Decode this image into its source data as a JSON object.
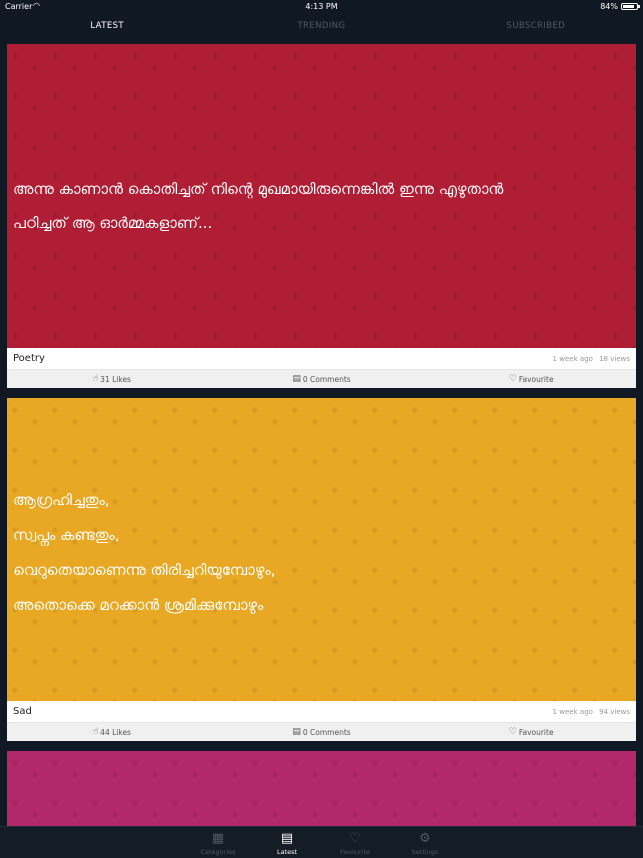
{
  "status_bar": {
    "carrier": "Carrier",
    "time": "4:13 PM",
    "battery_percent": "84%",
    "battery_level": 0.84
  },
  "tabs": [
    {
      "label": "LATEST",
      "active": true
    },
    {
      "label": "TRENDING",
      "active": false
    },
    {
      "label": "SUBSCRIBED",
      "active": false
    }
  ],
  "posts": [
    {
      "background": "#b01e35",
      "quote_lines": [
        "അന്നു കാണാൻ കൊതിച്ചത് നിന്റെ മുഖമായിരുന്നെങ്കിൽ ഇന്നു എഴുതാൻ",
        " പഠിച്ചത് ആ ഓർമ്മകളാണ്..."
      ],
      "category": "Poetry",
      "time_ago": "1 week ago",
      "views": "18 views",
      "likes": "31 Likes",
      "comments": "0 Comments",
      "favourite": "Favourite"
    },
    {
      "background": "#e8a823",
      "quote_lines": [
        "ആഗ്രഹിച്ചതും,",
        "സ്വപ്നം കണ്ടതും,",
        "വെറുതെയാണെന്നു തിരിച്ചറിയുമ്പോഴും,",
        "അതൊക്കെ മറക്കാൻ ശ്രമിക്കുമ്പോഴും"
      ],
      "category": "Sad",
      "time_ago": "1 week ago",
      "views": "94 views",
      "likes": "44 Likes",
      "comments": "0 Comments",
      "favourite": "Favourite"
    },
    {
      "background": "#b3286a",
      "quote_lines": []
    }
  ],
  "bottom_nav": [
    {
      "label": "Categories",
      "icon": "grid-icon",
      "active": false
    },
    {
      "label": "Latest",
      "icon": "chat-bubbles-icon",
      "active": true
    },
    {
      "label": "Favourite",
      "icon": "heart-icon",
      "active": false
    },
    {
      "label": "Settings",
      "icon": "gear-icon",
      "active": false
    }
  ]
}
